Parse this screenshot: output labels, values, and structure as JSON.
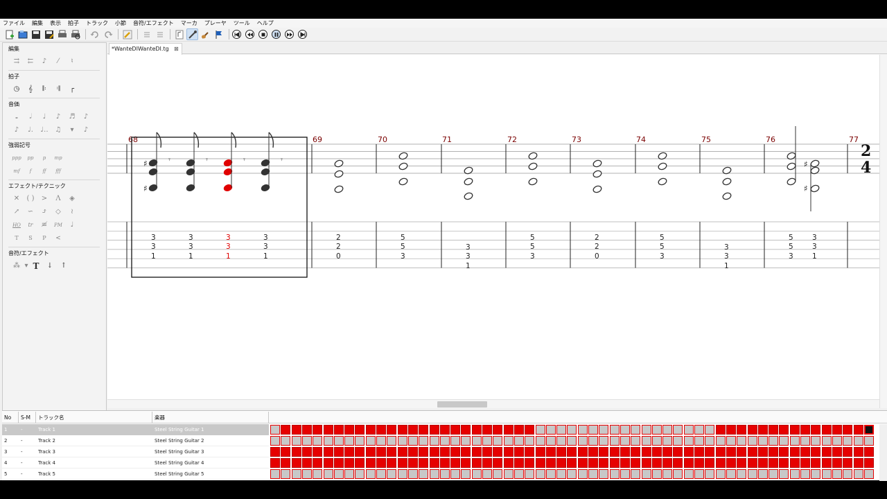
{
  "menu": [
    "ファイル",
    "編集",
    "表示",
    "拍子",
    "トラック",
    "小節",
    "音符/エフェクト",
    "マーカ",
    "プレーヤ",
    "ツール",
    "ヘルプ"
  ],
  "left_panel": {
    "sections": [
      {
        "title": "編集"
      },
      {
        "title": "拍子"
      },
      {
        "title": "音価"
      },
      {
        "title": "強弱記号",
        "labels": [
          "ppp",
          "pp",
          "p",
          "mp",
          "mf",
          "f",
          "ff",
          "fff"
        ]
      },
      {
        "title": "エフェクト/テクニック",
        "labels": [
          "HO",
          "tr",
          "PM",
          "T",
          "S",
          "P",
          "<"
        ]
      },
      {
        "title": "音符/エフェクト",
        "labels": [
          "T"
        ]
      }
    ]
  },
  "document_tab": {
    "label": "*WanteDIWanteDI.tg",
    "close": "⊠"
  },
  "score": {
    "measures": [
      {
        "number": "68",
        "tab": [
          [
            "3",
            "3",
            "1"
          ],
          [
            "3",
            "3",
            "1"
          ],
          [
            "3",
            "3",
            "1"
          ],
          [
            "3",
            "3",
            "1"
          ]
        ]
      },
      {
        "number": "69",
        "tab": [
          [
            "2",
            "2",
            "0"
          ]
        ]
      },
      {
        "number": "70",
        "tab": [
          [
            "5",
            "5",
            "3"
          ]
        ]
      },
      {
        "number": "71",
        "tab": [
          [
            "3",
            "3",
            "1"
          ]
        ]
      },
      {
        "number": "72",
        "tab": [
          [
            "5",
            "5",
            "3"
          ]
        ]
      },
      {
        "number": "73",
        "tab": [
          [
            "2",
            "2",
            "0"
          ]
        ]
      },
      {
        "number": "74",
        "tab": [
          [
            "5",
            "5",
            "3"
          ]
        ]
      },
      {
        "number": "75",
        "tab": [
          [
            "3",
            "3",
            "1"
          ]
        ]
      },
      {
        "number": "76",
        "tab": [
          [
            "5",
            "5",
            "3"
          ],
          [
            "3",
            "3",
            "1"
          ]
        ]
      },
      {
        "number": "77"
      }
    ],
    "time_signature": {
      "top": "2",
      "bottom": "4"
    },
    "colors": {
      "measure_number": "#7a0000",
      "selected_note": "#e00000",
      "note": "#333333"
    }
  },
  "tracks": {
    "headers": [
      "No",
      "S-M",
      "トラック名",
      "楽器"
    ],
    "rows": [
      {
        "no": "1",
        "sm": "-",
        "name": "Track 1",
        "instrument": "Steel String Guitar 1"
      },
      {
        "no": "2",
        "sm": "-",
        "name": "Track 2",
        "instrument": "Steel String Guitar 2"
      },
      {
        "no": "3",
        "sm": "-",
        "name": "Track 3",
        "instrument": "Steel String Guitar 3"
      },
      {
        "no": "4",
        "sm": "-",
        "name": "Track 4",
        "instrument": "Steel String Guitar 4"
      },
      {
        "no": "5",
        "sm": "-",
        "name": "Track 5",
        "instrument": "Steel String Guitar 5"
      }
    ],
    "colors": {
      "filled": "#e60000",
      "empty": "#c8c8c8"
    }
  }
}
